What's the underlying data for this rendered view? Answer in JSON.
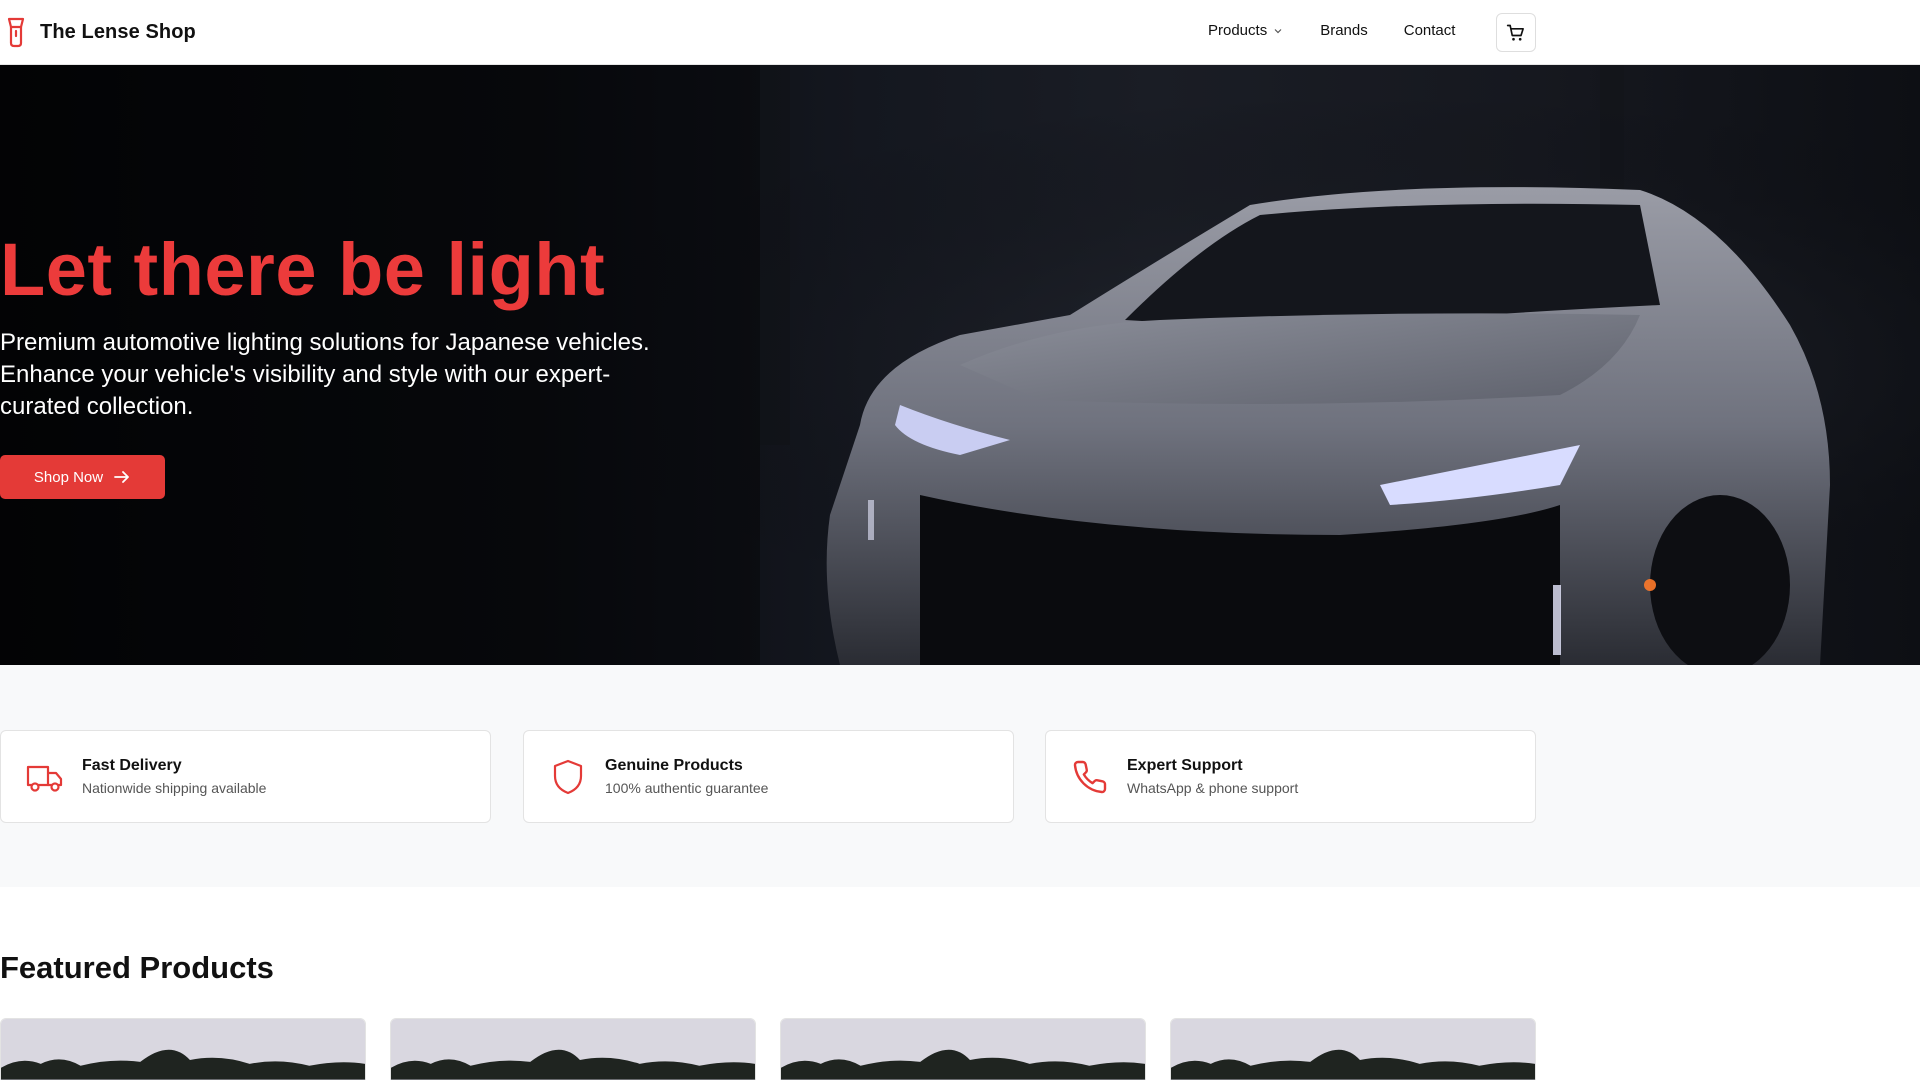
{
  "header": {
    "brand": "The Lense Shop",
    "nav": [
      {
        "label": "Products",
        "has_dropdown": true
      },
      {
        "label": "Brands"
      },
      {
        "label": "Contact"
      }
    ],
    "icons": {
      "logo": "headlight-bulb-icon",
      "cart": "cart-icon",
      "dropdown": "chevron-down-icon"
    }
  },
  "hero": {
    "title": "Let there be light",
    "subtitle": "Premium automotive lighting solutions for Japanese vehicles. Enhance your vehicle's visibility and style with our expert-curated collection.",
    "cta_label": "Shop Now",
    "cta_icon": "arrow-right-icon"
  },
  "features": [
    {
      "title": "Fast Delivery",
      "desc": "Nationwide shipping available",
      "icon": "truck-icon"
    },
    {
      "title": "Genuine Products",
      "desc": "100% authentic guarantee",
      "icon": "shield-icon"
    },
    {
      "title": "Expert Support",
      "desc": "WhatsApp & phone support",
      "icon": "phone-icon"
    }
  ],
  "featured": {
    "heading": "Featured Products"
  },
  "colors": {
    "accent": "#e43a37",
    "title_red": "#ec3b3b",
    "section_bg": "#f8f9fa"
  }
}
